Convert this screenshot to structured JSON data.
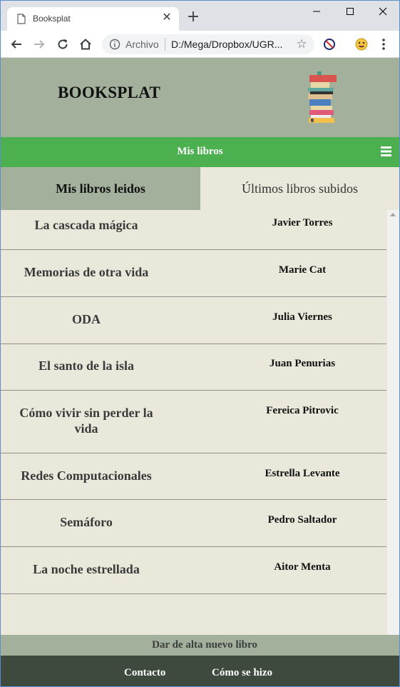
{
  "browser": {
    "tab_title": "Booksplat",
    "omnibox_site": "Archivo",
    "url": "D:/Mega/Dropbox/UGR..."
  },
  "site": {
    "brand": "BOOKSPLAT",
    "nav_title": "Mis libros",
    "tabs": [
      {
        "label": "Mis libros leidos",
        "active": true
      },
      {
        "label": "Últimos libros subidos",
        "active": false
      }
    ],
    "books": [
      {
        "title": "La cascada mágica",
        "author": "Javier Torres"
      },
      {
        "title": "Memorias de otra vida",
        "author": "Marie Cat"
      },
      {
        "title": "ODA",
        "author": "Julia Viernes"
      },
      {
        "title": "El santo de la isla",
        "author": "Juan Penurias"
      },
      {
        "title": "Cómo vivir sin perder la vida",
        "author": "Fereica Pitrovic"
      },
      {
        "title": "Redes Computacionales",
        "author": "Estrella Levante"
      },
      {
        "title": "Semáforo",
        "author": "Pedro Saltador"
      },
      {
        "title": "La noche estrellada",
        "author": "Aitor Menta"
      }
    ],
    "add_book_label": "Dar de alta nuevo libro",
    "footer_links": [
      "Contacto",
      "Cómo se hizo"
    ]
  },
  "colors": {
    "header_bg": "#a2b09c",
    "nav_bg": "#4caf50",
    "page_bg": "#e9e8da",
    "footer_bg": "#3e4a3d"
  }
}
